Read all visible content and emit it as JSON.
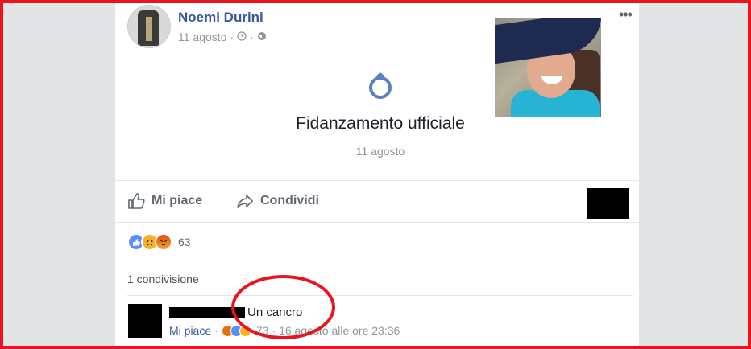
{
  "post": {
    "author": "Noemi Durini",
    "date": "11 agosto",
    "meta_sep": "·"
  },
  "event": {
    "title": "Fidanzamento ufficiale",
    "date": "11 agosto"
  },
  "actions": {
    "like_label": "Mi piace",
    "share_label": "Condividi"
  },
  "reactions": {
    "count": "63",
    "types": [
      "like",
      "sad",
      "angry"
    ]
  },
  "shares": {
    "label": "1 condivisione"
  },
  "comment": {
    "text": "Un cancro",
    "like_label": "Mi piace",
    "reactions_count": "73",
    "timestamp": "16 agosto alle ore 23:36",
    "sep": "·"
  },
  "colors": {
    "link": "#365899",
    "highlight": "#e8141e",
    "like_blue": "#5890ff",
    "sad_yellow": "#f7b125",
    "angry_red": "#e9710f"
  }
}
